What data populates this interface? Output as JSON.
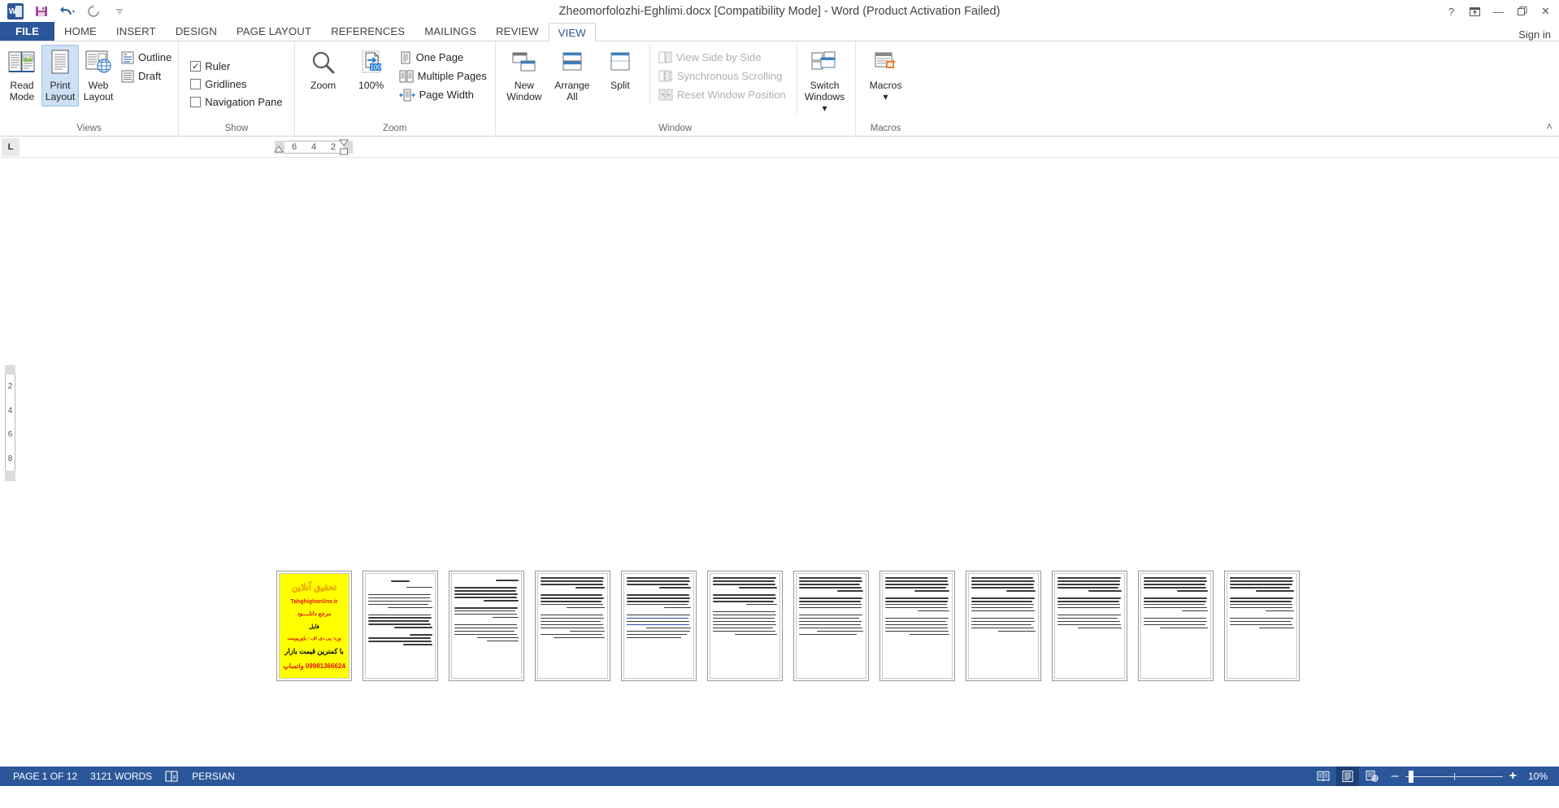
{
  "titlebar": {
    "app_icon": "word-logo-icon",
    "quick_access": [
      {
        "name": "save-icon",
        "glyph": "὚B"
      },
      {
        "name": "undo-icon",
        "glyph": "↶"
      },
      {
        "name": "redo-icon",
        "glyph": "↻"
      },
      {
        "name": "customize-qat-icon",
        "glyph": "≡"
      }
    ],
    "title": "Zheomorfolozhi-Eghlimi.docx [Compatibility Mode] - Word (Product Activation Failed)",
    "help_label": "?",
    "ribbon_display_label": "⤒",
    "minimize_label": "—",
    "restore_label": "❐",
    "close_label": "✕"
  },
  "tabs": [
    {
      "label": "FILE",
      "id": "file",
      "active": false
    },
    {
      "label": "HOME",
      "id": "home",
      "active": false
    },
    {
      "label": "INSERT",
      "id": "insert",
      "active": false
    },
    {
      "label": "DESIGN",
      "id": "design",
      "active": false
    },
    {
      "label": "PAGE LAYOUT",
      "id": "page-layout",
      "active": false
    },
    {
      "label": "REFERENCES",
      "id": "references",
      "active": false
    },
    {
      "label": "MAILINGS",
      "id": "mailings",
      "active": false
    },
    {
      "label": "REVIEW",
      "id": "review",
      "active": false
    },
    {
      "label": "VIEW",
      "id": "view",
      "active": true
    }
  ],
  "signin_label": "Sign in",
  "ribbon": {
    "collapse_label": "˄",
    "groups": [
      {
        "label": "Views",
        "buttons": [
          {
            "label_line1": "Read",
            "label_line2": "Mode",
            "name": "read-mode-button",
            "selected": false
          },
          {
            "label_line1": "Print",
            "label_line2": "Layout",
            "name": "print-layout-button",
            "selected": true
          },
          {
            "label_line1": "Web",
            "label_line2": "Layout",
            "name": "web-layout-button",
            "selected": false
          }
        ],
        "small_items": [
          {
            "label": "Outline",
            "name": "outline-button"
          },
          {
            "label": "Draft",
            "name": "draft-button"
          }
        ]
      },
      {
        "label": "Show",
        "checkboxes": [
          {
            "label": "Ruler",
            "checked": true,
            "name": "ruler-checkbox"
          },
          {
            "label": "Gridlines",
            "checked": false,
            "name": "gridlines-checkbox"
          },
          {
            "label": "Navigation Pane",
            "checked": false,
            "name": "navigation-pane-checkbox"
          }
        ]
      },
      {
        "label": "Zoom",
        "buttons": [
          {
            "label_line1": "Zoom",
            "label_line2": "",
            "name": "zoom-button"
          },
          {
            "label_line1": "100%",
            "label_line2": "",
            "name": "zoom-100-button"
          }
        ],
        "small_items": [
          {
            "label": "One Page",
            "name": "one-page-button"
          },
          {
            "label": "Multiple Pages",
            "name": "multiple-pages-button"
          },
          {
            "label": "Page Width",
            "name": "page-width-button"
          }
        ]
      },
      {
        "label": "Window",
        "buttons": [
          {
            "label_line1": "New",
            "label_line2": "Window",
            "name": "new-window-button"
          },
          {
            "label_line1": "Arrange",
            "label_line2": "All",
            "name": "arrange-all-button"
          },
          {
            "label_line1": "Split",
            "label_line2": "",
            "name": "split-button"
          }
        ],
        "small_items": [
          {
            "label": "View Side by Side",
            "name": "view-side-by-side-button",
            "disabled": true
          },
          {
            "label": "Synchronous Scrolling",
            "name": "synchronous-scrolling-button",
            "disabled": true
          },
          {
            "label": "Reset Window Position",
            "name": "reset-window-position-button",
            "disabled": true
          }
        ],
        "buttons2": [
          {
            "label_line1": "Switch",
            "label_line2": "Windows ▾",
            "name": "switch-windows-button"
          }
        ]
      },
      {
        "label": "Macros",
        "buttons": [
          {
            "label_line1": "Macros",
            "label_line2": "▾",
            "name": "macros-button"
          }
        ]
      }
    ]
  },
  "ruler": {
    "tab_stop_label": "L",
    "ticks": [
      "6",
      "4",
      "2"
    ],
    "vertical_ticks": [
      "2",
      "4",
      "6",
      "8"
    ]
  },
  "document": {
    "cover": {
      "title": "تحقیق آنلاین",
      "site": "Tahghighonline.ir",
      "line1": "مرجع دانلــــود",
      "line2": "فایل",
      "line3": "ورد- پی دی اف - پاورپوینت",
      "line4": "با کمترین قیمت بازار",
      "phone": "09981366624 واتساپ"
    },
    "page_count": 12
  },
  "statusbar": {
    "page_label": "PAGE 1 OF 12",
    "words_label": "3121 WORDS",
    "proofing_icon": "spelling-check-icon",
    "language_label": "PERSIAN",
    "views": [
      {
        "name": "read-mode-view-icon",
        "active": false
      },
      {
        "name": "print-layout-view-icon",
        "active": true
      },
      {
        "name": "web-layout-view-icon",
        "active": false
      }
    ],
    "zoom_out_label": "–",
    "zoom_in_label": "+",
    "zoom_level": "10%"
  },
  "colors": {
    "brand": "#2b579a",
    "ribbon_selected": "#cde0f5",
    "accent_blue": "#4a7ebb",
    "cover_bg": "#ffff00",
    "cover_red": "#dd1111"
  }
}
